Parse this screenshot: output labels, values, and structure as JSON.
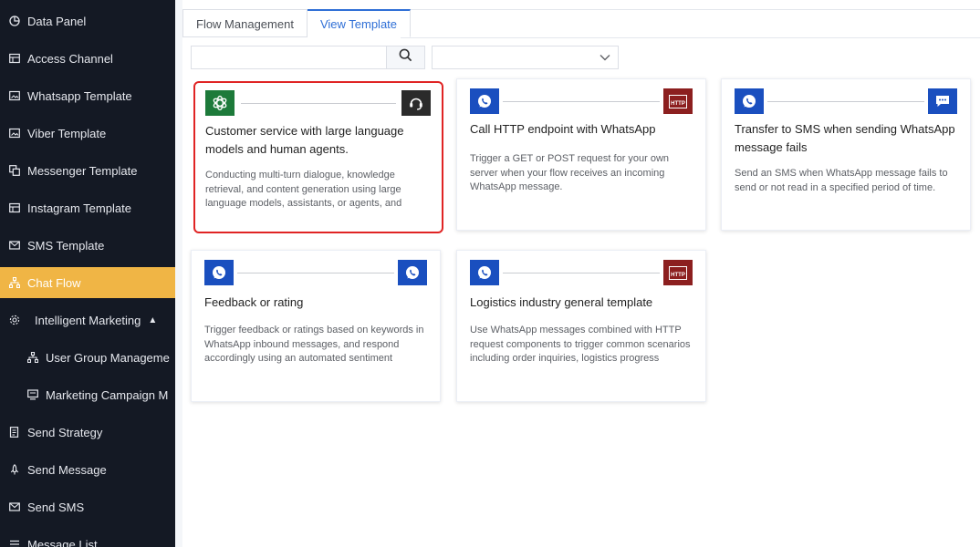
{
  "sidebar": {
    "items": [
      {
        "label": "Data Panel",
        "icon": "pie-chart-icon"
      },
      {
        "label": "Access Channel",
        "icon": "grid-icon"
      },
      {
        "label": "Whatsapp Template",
        "icon": "image-icon"
      },
      {
        "label": "Viber Template",
        "icon": "image-icon"
      },
      {
        "label": "Messenger Template",
        "icon": "copy-icon"
      },
      {
        "label": "Instagram Template",
        "icon": "grid-icon"
      },
      {
        "label": "SMS Template",
        "icon": "mail-icon"
      },
      {
        "label": "Chat Flow",
        "icon": "flow-icon",
        "active": true
      },
      {
        "label": "Intelligent Marketing",
        "icon": "gear-icon",
        "expanded": true
      },
      {
        "label": "User Group Manageme",
        "icon": "org-icon"
      },
      {
        "label": "Marketing Campaign M",
        "icon": "message-icon"
      },
      {
        "label": "Send Strategy",
        "icon": "document-icon"
      },
      {
        "label": "Send Message",
        "icon": "rocket-icon"
      },
      {
        "label": "Send SMS",
        "icon": "mail-icon"
      },
      {
        "label": "Message List",
        "icon": "list-icon"
      }
    ]
  },
  "tabs": [
    {
      "label": "Flow Management"
    },
    {
      "label": "View Template",
      "active": true
    }
  ],
  "search": {
    "placeholder": "",
    "value": ""
  },
  "filter": {
    "selected": ""
  },
  "cards": [
    {
      "title": "Customer service with large language models and human agents.",
      "description": "Conducting multi-turn dialogue, knowledge retrieval, and content generation using large language models, assistants, or agents, and",
      "left_icon": "openai-icon",
      "right_icon": "agent-headset-icon",
      "selected": true
    },
    {
      "title": "Call HTTP endpoint with WhatsApp",
      "description": "Trigger a GET or POST request for your own server when your flow receives an incoming WhatsApp message.",
      "left_icon": "whatsapp-icon",
      "right_icon": "http-icon",
      "right_icon_text": "HTTP"
    },
    {
      "title": "Transfer to SMS when sending WhatsApp message fails",
      "description": "Send an SMS when WhatsApp message fails to send or not read in a specified period of time.",
      "left_icon": "whatsapp-icon",
      "right_icon": "sms-icon"
    },
    {
      "title": "Feedback or rating",
      "description": "Trigger feedback or ratings based on keywords in WhatsApp inbound messages, and respond accordingly using an automated sentiment",
      "left_icon": "whatsapp-icon",
      "right_icon": "whatsapp-icon"
    },
    {
      "title": "Logistics industry general template",
      "description": "Use WhatsApp messages combined with HTTP request components to trigger common scenarios including order inquiries, logistics progress",
      "left_icon": "whatsapp-icon",
      "right_icon": "http-icon",
      "right_icon_text": "HTTP"
    }
  ],
  "colors": {
    "sidebar_bg": "#141924",
    "active_item": "#f0b545",
    "tab_accent": "#2f6fd6",
    "selected_border": "#e02424",
    "whatsapp_box": "#1a4fbf",
    "http_box": "#8c1f1f",
    "openai_box": "#1d7a3a"
  }
}
